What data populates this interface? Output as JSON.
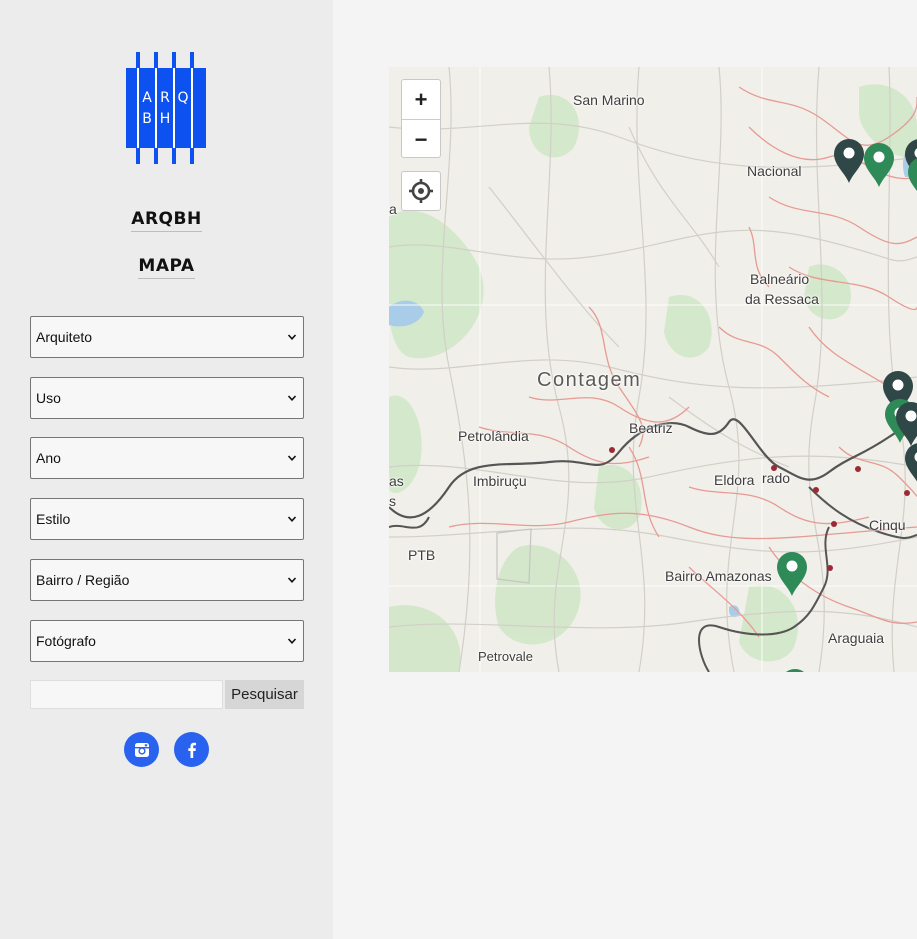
{
  "brand": {
    "logo_letters": [
      "A",
      "R",
      "Q",
      "B",
      "H"
    ],
    "color": "#0d52f0"
  },
  "nav": {
    "home_label": "ARQBH",
    "map_label": "MAPA"
  },
  "filters": [
    {
      "id": "architect",
      "label": "Arquiteto"
    },
    {
      "id": "use",
      "label": "Uso"
    },
    {
      "id": "year",
      "label": "Ano"
    },
    {
      "id": "style",
      "label": "Estilo"
    },
    {
      "id": "neighborhood",
      "label": "Bairro / Região"
    },
    {
      "id": "photographer",
      "label": "Fotógrafo"
    }
  ],
  "search": {
    "value": "",
    "button_label": "Pesquisar"
  },
  "social": [
    {
      "name": "instagram",
      "color": "#2962ee"
    },
    {
      "name": "facebook",
      "color": "#2962ee"
    }
  ],
  "map": {
    "controls": {
      "zoom_in": "+",
      "zoom_out": "−"
    },
    "places": [
      "San Marino",
      "Nacional",
      "Balneário",
      "da Ressaca",
      "Contagem",
      "Petrolândia",
      "Beatriz",
      "Eldora",
      "rado",
      "Imbiruçu",
      "as",
      "s",
      "a",
      "PTB",
      "Cinqu",
      "Bairro Amazonas",
      "Araguaia",
      "Petrovale"
    ],
    "marker_colors": {
      "dark": "#2f4747",
      "green": "#2e8b57"
    }
  }
}
